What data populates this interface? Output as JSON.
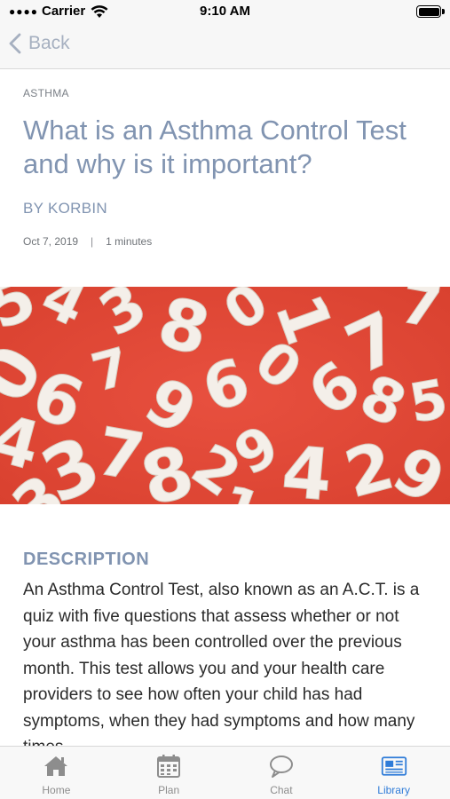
{
  "status_bar": {
    "carrier": "Carrier",
    "time": "9:10 AM"
  },
  "nav": {
    "back_label": "Back"
  },
  "article": {
    "category": "ASTHMA",
    "title": "What is an Asthma Control Test and why is it important?",
    "author": "BY KORBIN",
    "date": "Oct 7, 2019",
    "separator": "|",
    "read_time": "1 minutes",
    "description_heading": "DESCRIPTION",
    "description_body": "An Asthma Control Test, also known as an A.C.T. is a quiz with five questions that assess whether or not your asthma has been controlled over the previous month. This test allows you and your health care providers to see how often your child has had symptoms, when they had symptoms and how many times"
  },
  "tabs": [
    {
      "label": "Home",
      "icon": "home-icon",
      "active": false
    },
    {
      "label": "Plan",
      "icon": "calendar-icon",
      "active": false
    },
    {
      "label": "Chat",
      "icon": "chat-bubble-icon",
      "active": false
    },
    {
      "label": "Library",
      "icon": "newspaper-icon",
      "active": true
    }
  ],
  "colors": {
    "accent": "#8194b1",
    "active_tab": "#2f7cd8",
    "inactive_tab": "#8d8d8d",
    "hero_background": "#e2493b"
  }
}
